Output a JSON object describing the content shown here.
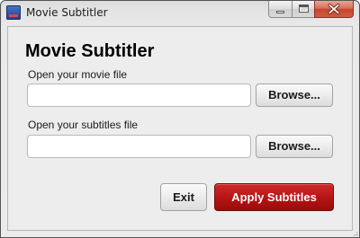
{
  "window": {
    "title": "Movie Subtitler",
    "icon": "film-app-icon"
  },
  "caption_buttons": {
    "minimize_icon": "minimize-icon",
    "maximize_icon": "maximize-icon",
    "close_icon": "close-icon",
    "close_color": "#c7462b"
  },
  "main": {
    "heading": "Movie Subtitler",
    "movie": {
      "label": "Open your movie file",
      "value": "",
      "placeholder": "",
      "browse_label": "Browse..."
    },
    "subtitles": {
      "label": "Open your subtitles file",
      "value": "",
      "placeholder": "",
      "browse_label": "Browse..."
    }
  },
  "actions": {
    "exit_label": "Exit",
    "apply_label": "Apply Subtitles",
    "apply_color": "#b51414"
  }
}
